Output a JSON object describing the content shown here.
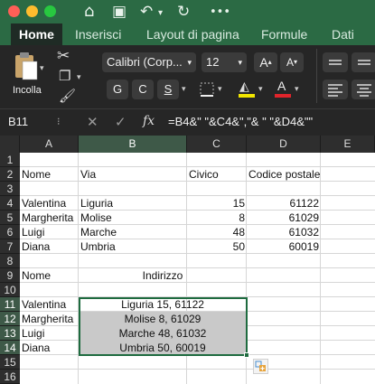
{
  "tabs": [
    "Home",
    "Inserisci",
    "Layout di pagina",
    "Formule",
    "Dati"
  ],
  "ribbon": {
    "paste_label": "Incolla",
    "font_name": "Calibri (Corp...",
    "font_size": "12",
    "bold": "G",
    "italic": "C",
    "underline": "S",
    "grow_font": "A",
    "shrink_font": "A",
    "font_color_letter": "A",
    "font_color": "#e0242b",
    "fill_color": "#f2e600"
  },
  "formula_bar": {
    "cell_ref": "B11",
    "fx": "fx",
    "formula": "=B4&\" \"&C4&\",\"& \" \"&D4&\"\""
  },
  "columns": [
    "A",
    "B",
    "C",
    "D",
    "E"
  ],
  "rows": [
    "1",
    "2",
    "3",
    "4",
    "5",
    "6",
    "7",
    "8",
    "9",
    "10",
    "11",
    "12",
    "13",
    "14",
    "15",
    "16"
  ],
  "cells": {
    "r2": {
      "a": "Nome",
      "b": "Via",
      "c": "Civico",
      "d": "Codice postale"
    },
    "r4": {
      "a": "Valentina",
      "b": "Liguria",
      "c": "15",
      "d": "61122"
    },
    "r5": {
      "a": "Margherita",
      "b": "Molise",
      "c": "8",
      "d": "61029"
    },
    "r6": {
      "a": "Luigi",
      "b": "Marche",
      "c": "48",
      "d": "61032"
    },
    "r7": {
      "a": "Diana",
      "b": "Umbria",
      "c": "50",
      "d": "60019"
    },
    "r9": {
      "a": "Nome",
      "b": "Indirizzo"
    },
    "r11": {
      "a": "Valentina",
      "b": "Liguria 15, 61122"
    },
    "r12": {
      "a": "Margherita",
      "b": "Molise 8, 61029"
    },
    "r13": {
      "a": "Luigi",
      "b": "Marche 48, 61032"
    },
    "r14": {
      "a": "Diana",
      "b": "Umbria 50, 60019"
    }
  },
  "accent_color": "#1e6b3f",
  "selection_fill": "#c9c9c9"
}
